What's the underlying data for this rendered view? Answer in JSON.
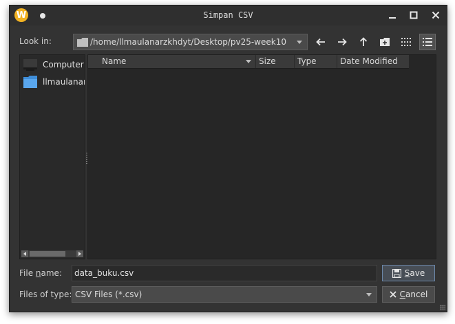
{
  "window": {
    "title": "Simpan CSV"
  },
  "toolbar": {
    "look_in_label": "Look in:",
    "path": "/home/llmaulanarzkhdyt/Desktop/pv25-week10"
  },
  "sidebar": {
    "items": [
      {
        "label": "Computer",
        "icon": "computer-icon"
      },
      {
        "label": "llmaulanar",
        "icon": "folder-icon"
      }
    ]
  },
  "filelist": {
    "columns": [
      "Name",
      "Size",
      "Type",
      "Date Modified"
    ]
  },
  "filename": {
    "label_pre": "File ",
    "label_u": "n",
    "label_post": "ame:",
    "value": "data_buku.csv"
  },
  "filetype": {
    "label": "Files of type:",
    "value": "CSV Files (*.csv)"
  },
  "buttons": {
    "save_u": "S",
    "save_rest": "ave",
    "cancel_pre": "",
    "cancel_u": "C",
    "cancel_rest": "ancel"
  },
  "colors": {
    "window_bg": "#333333",
    "accent_border": "#6b86a8",
    "app_icon": "#f3b323",
    "folder": "#3f8ed9"
  }
}
